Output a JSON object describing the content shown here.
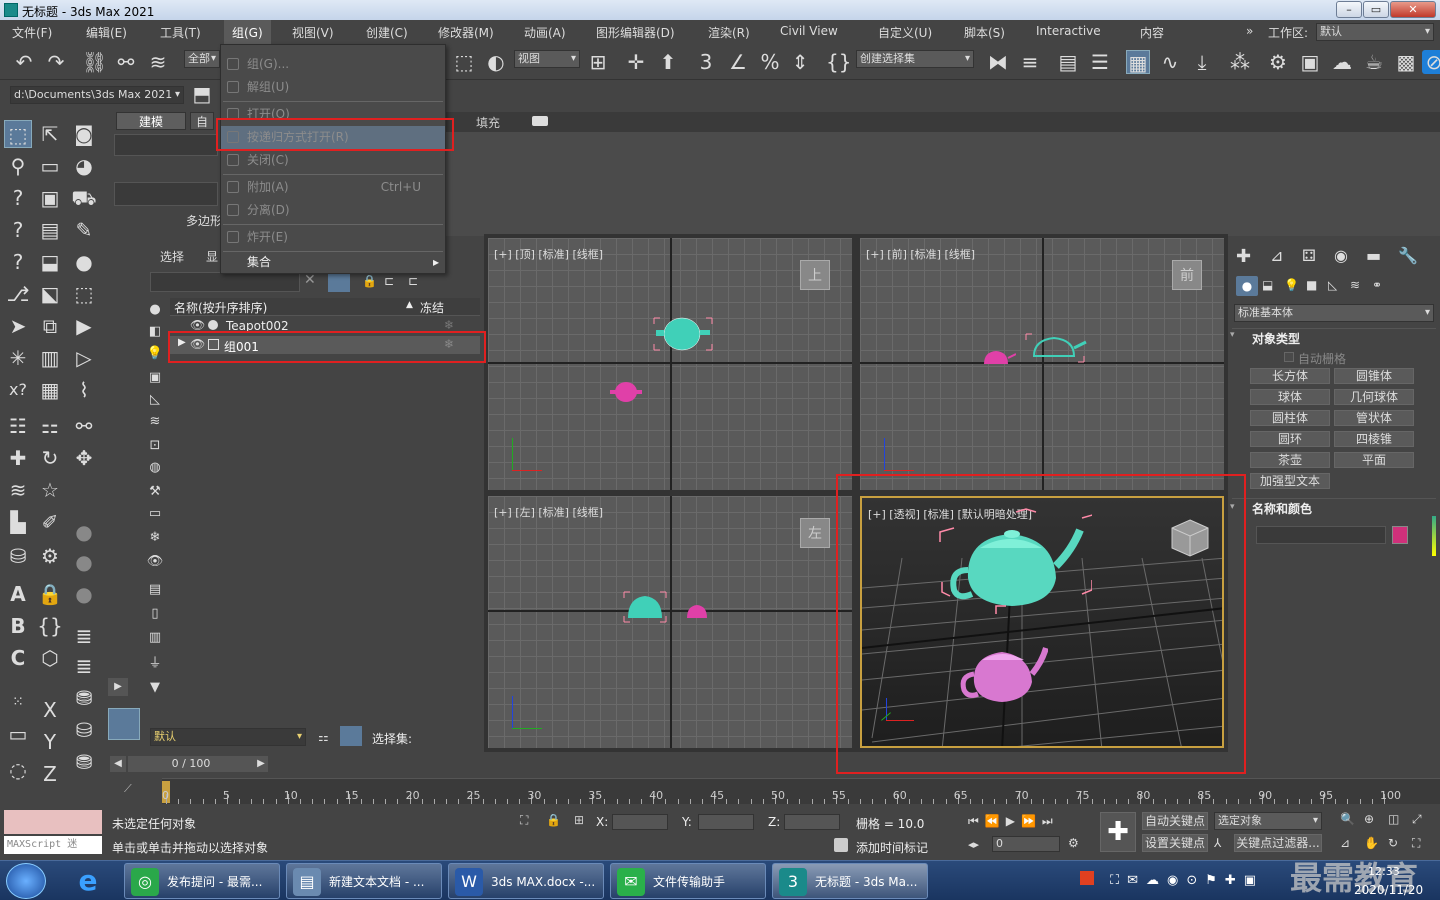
{
  "window": {
    "title": "无标题 - 3ds Max 2021",
    "min": "–",
    "max": "▭",
    "close": "✕"
  },
  "menubar": {
    "items": [
      "文件(F)",
      "编辑(E)",
      "工具(T)",
      "组(G)",
      "视图(V)",
      "创建(C)",
      "修改器(M)",
      "动画(A)",
      "图形编辑器(D)",
      "渲染(R)",
      "Civil View",
      "自定义(U)",
      "脚本(S)",
      "Interactive",
      "内容"
    ],
    "workspace_label": "工作区:",
    "workspace_value": "默认",
    "chevron": "»"
  },
  "group_menu": {
    "items": [
      {
        "label": "组(G)...",
        "enabled": false
      },
      {
        "label": "解组(U)",
        "enabled": false
      },
      {
        "label": "打开(O)",
        "enabled": false
      },
      {
        "label": "按递归方式打开(R)",
        "enabled": false,
        "highlighted": true
      },
      {
        "label": "关闭(C)",
        "enabled": false
      },
      {
        "label": "附加(A)",
        "enabled": false,
        "shortcut": "Ctrl+U"
      },
      {
        "label": "分离(D)",
        "enabled": false
      },
      {
        "label": "炸开(E)",
        "enabled": false
      },
      {
        "label": "集合",
        "enabled": true,
        "submenu": "▸"
      }
    ]
  },
  "toolbar": {
    "filter_all": "全部",
    "view_dropdown": "视图",
    "selection_set": "创建选择集",
    "path": "d:\\Documents\\3ds Max 2021",
    "fill_label": "填充"
  },
  "ribbon": {
    "tab_modeling": "建模",
    "tab_free": "自",
    "poly_label": "多边形"
  },
  "scene_explorer": {
    "tab_select": "选择",
    "tab_display": "显",
    "col_name": "名称(按升序排序)",
    "col_freeze": "冻结",
    "sort_arrow": "▲",
    "rows": [
      {
        "name": "Teapot002",
        "selected": false
      },
      {
        "name": "组001",
        "selected": true
      }
    ],
    "layer_dropdown": "默认",
    "selection_set_label": "选择集:"
  },
  "viewports": {
    "top": "[+] [顶] [标准] [线框]",
    "front": "[+] [前] [标准] [线框]",
    "left": "[+] [左] [标准] [线框]",
    "persp": "[+] [透视] [标准] [默认明暗处理]",
    "cube_top": "上",
    "cube_front": "前",
    "cube_left": "左"
  },
  "command_panel": {
    "category": "标准基本体",
    "section_object_type": "对象类型",
    "auto_grid": "自动栅格",
    "buttons": [
      "长方体",
      "圆锥体",
      "球体",
      "几何球体",
      "圆柱体",
      "管状体",
      "圆环",
      "四棱锥",
      "茶壶",
      "平面",
      "加强型文本"
    ],
    "section_name_color": "名称和颜色",
    "object_color": "#d0307a"
  },
  "timeline": {
    "frame_display": "0 / 100",
    "ticks": [
      "0",
      "5",
      "10",
      "15",
      "20",
      "25",
      "30",
      "35",
      "40",
      "45",
      "50",
      "55",
      "60",
      "65",
      "70",
      "75",
      "80",
      "85",
      "90",
      "95",
      "100"
    ]
  },
  "status": {
    "maxscript": "MAXScript 迷",
    "line1": "未选定任何对象",
    "line2": "单击或单击并拖动以选择对象",
    "x_label": "X:",
    "y_label": "Y:",
    "z_label": "Z:",
    "grid": "栅格 = 10.0",
    "add_time_tag": "添加时间标记",
    "auto_key": "自动关键点",
    "set_key": "设置关键点",
    "selected_obj": "选定对象",
    "key_filter": "关键点过滤器...",
    "frame_value": "0"
  },
  "taskbar": {
    "items": [
      {
        "label": "发布提问 - 最需...",
        "color": "#2aa84a"
      },
      {
        "label": "新建文本文档 - ...",
        "color": "#6a8ab0"
      },
      {
        "label": "3ds MAX.docx -...",
        "color": "#2a5aa8"
      },
      {
        "label": "文件传输助手",
        "color": "#2ab04a"
      },
      {
        "label": "无标题 - 3ds Ma...",
        "color": "#1a8a8a"
      }
    ],
    "time": "12:33",
    "date": "2020/11/20",
    "watermark": "最需教育"
  }
}
